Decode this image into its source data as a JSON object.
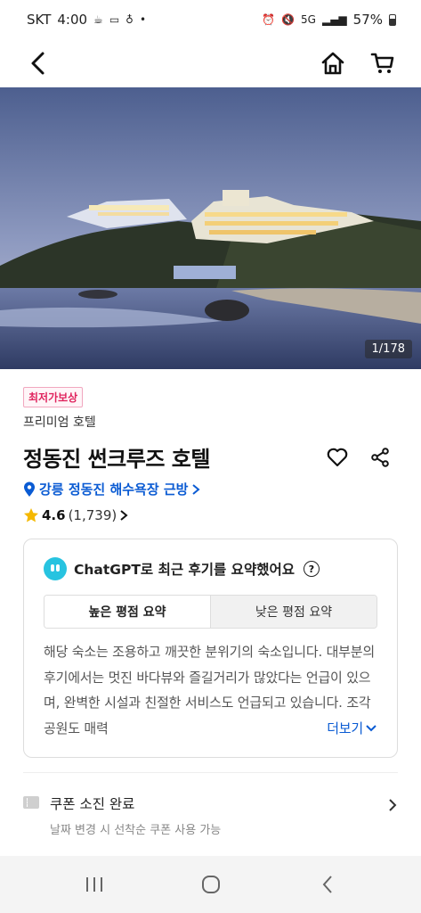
{
  "status_bar": {
    "carrier": "SKT",
    "time": "4:00",
    "network": "5G",
    "battery": "57%"
  },
  "hero": {
    "photo_counter": "1/178"
  },
  "hotel": {
    "badge": "최저가보상",
    "category": "프리미엄 호텔",
    "name": "정동진 썬크루즈 호텔",
    "location": "강릉 정동진 해수욕장 근방",
    "rating": "4.6",
    "review_count": "(1,739)"
  },
  "summary": {
    "title": "ChatGPT로 최근 후기를 요약했어요",
    "tabs": [
      {
        "label": "높은 평점 요약",
        "active": true
      },
      {
        "label": "낮은 평점 요약",
        "active": false
      }
    ],
    "text": "해당 숙소는 조용하고 깨끗한 분위기의 숙소입니다. 대부분의 후기에서는 멋진 바다뷰와 즐길거리가 많았다는 언급이 있으며, 완벽한 시설과 친절한 서비스도 언급되고 있습니다. 조각공원도 매력",
    "more_label": "더보기"
  },
  "coupon": {
    "title": "쿠폰 소진 완료",
    "subtitle": "날짜 변경 시 선착순 쿠폰 사용 가능"
  },
  "colors": {
    "accent_blue": "#0a5bd3",
    "badge_pink": "#e0245e",
    "star_yellow": "#f5b800"
  }
}
